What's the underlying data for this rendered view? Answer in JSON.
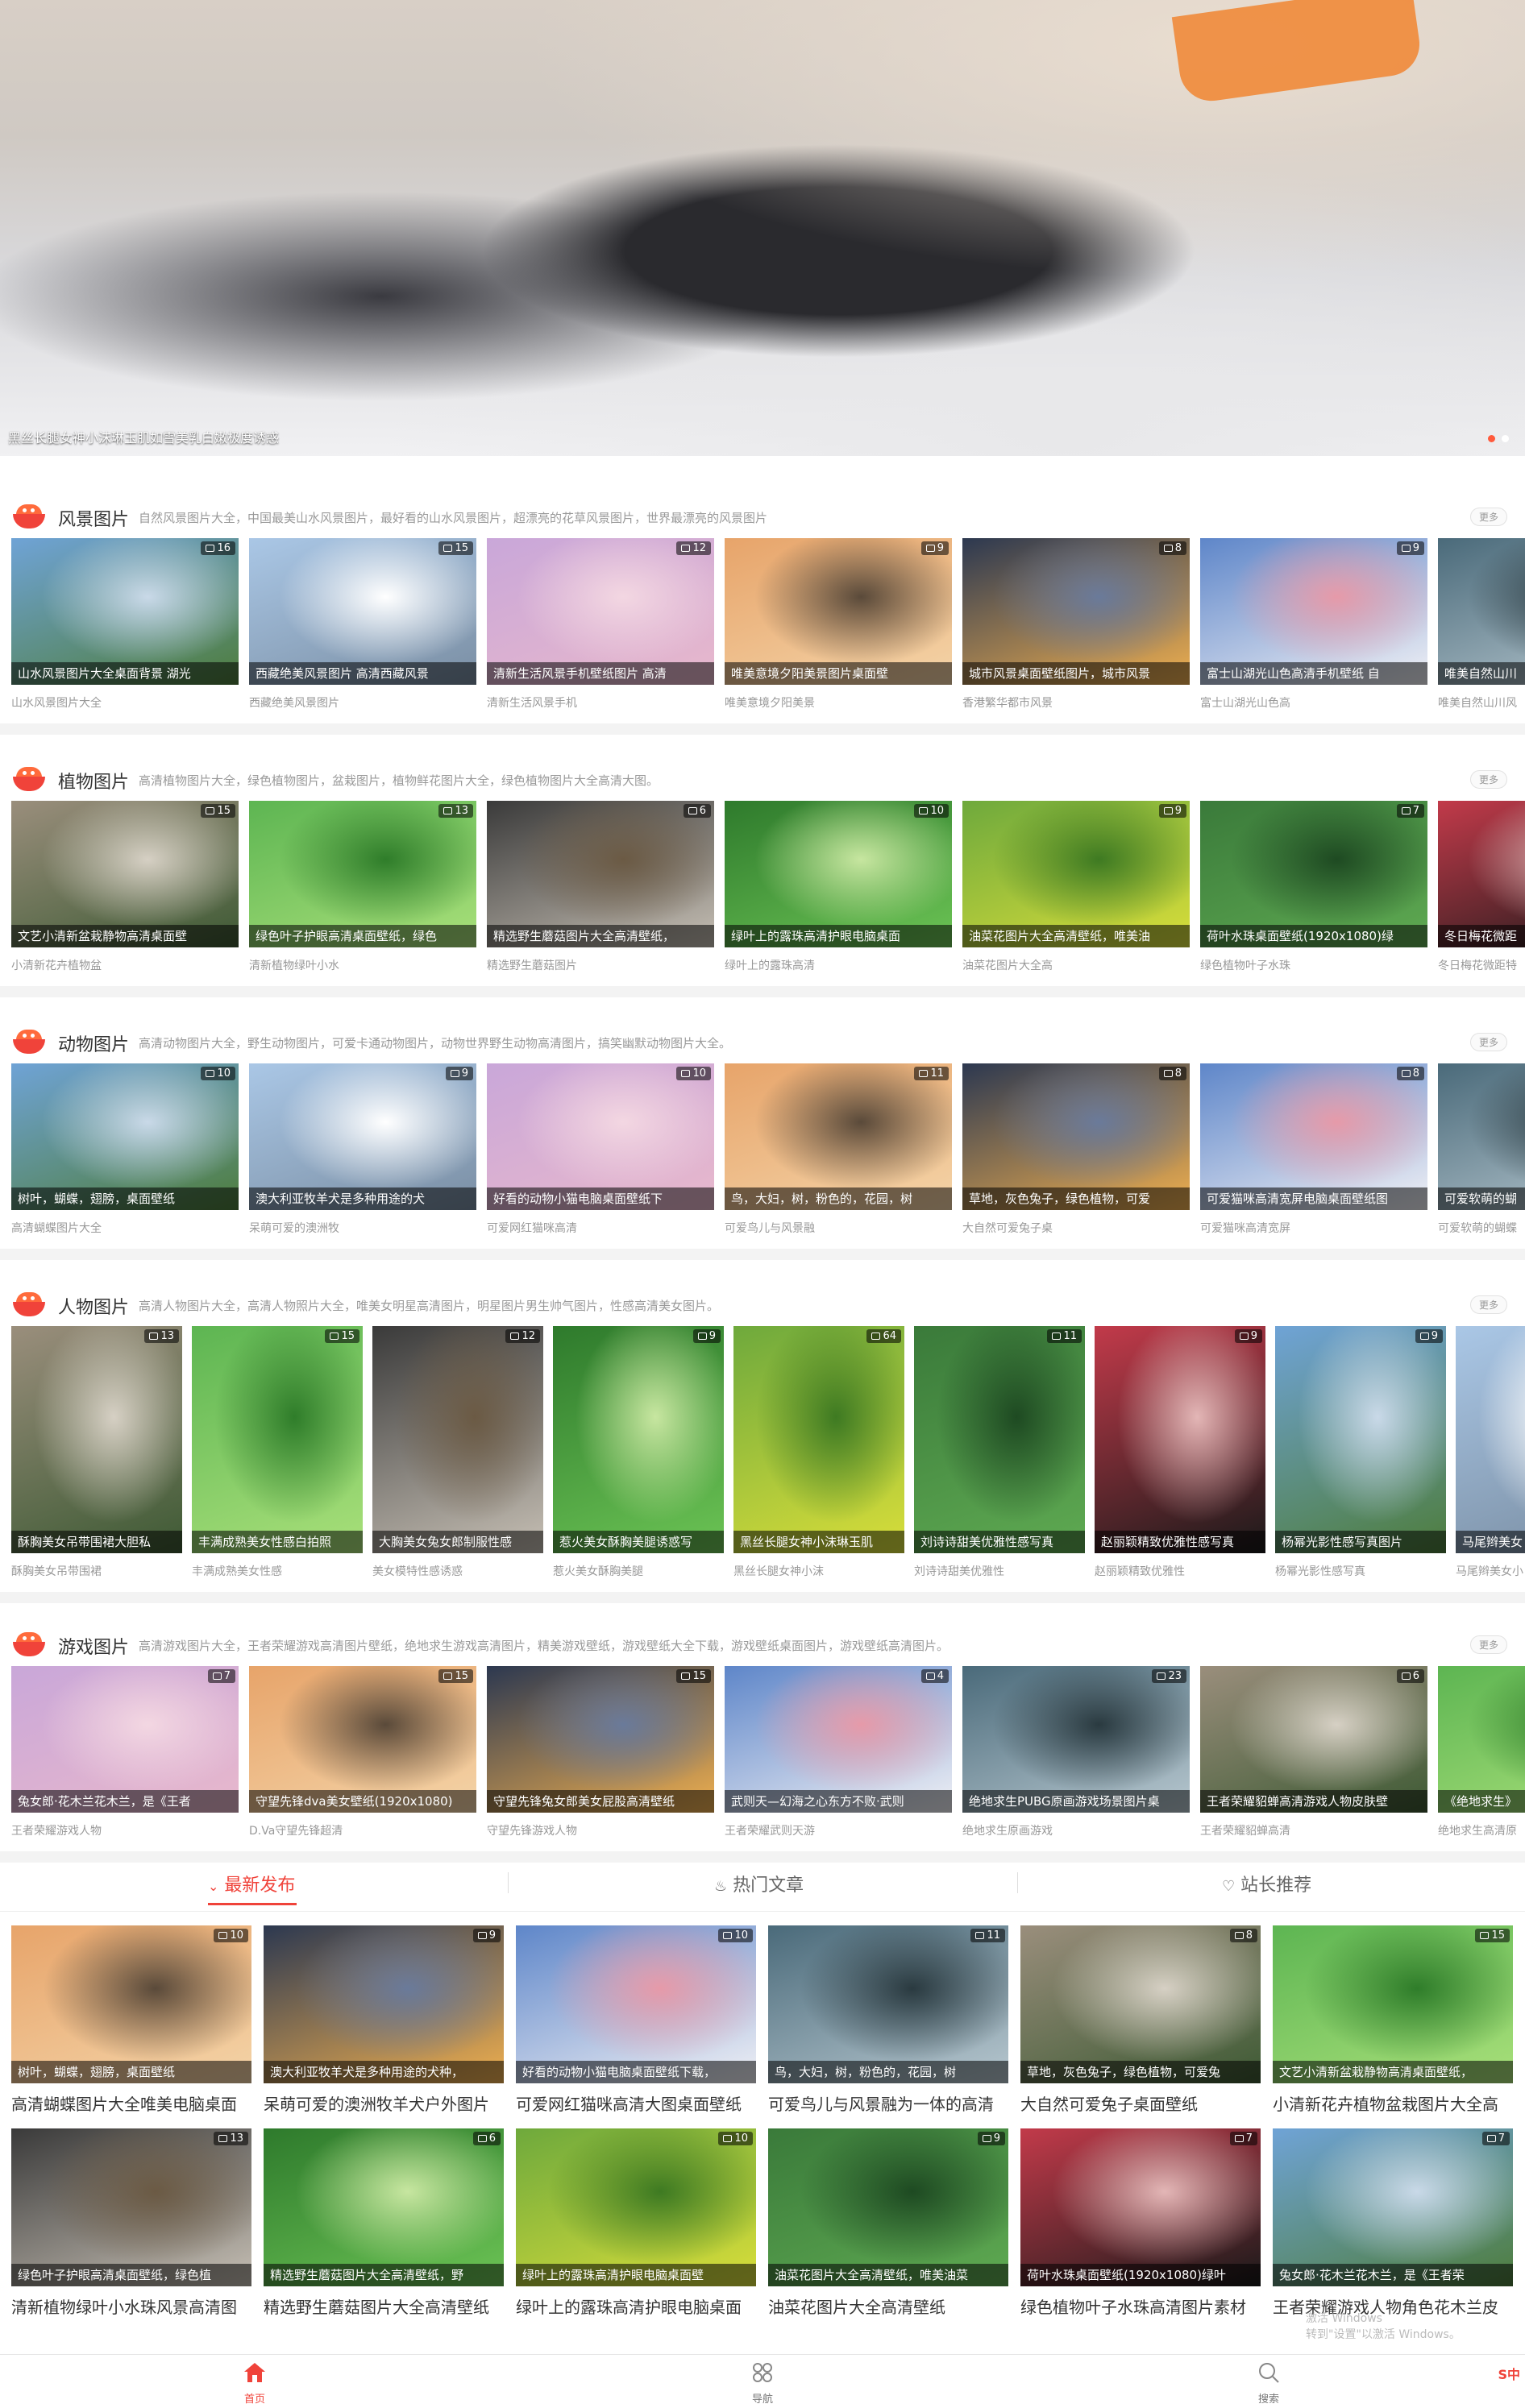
{
  "hero": {
    "caption": "黑丝长腿女神小沫琳玉肌如雪美乳白嫩极度诱惑",
    "dots": 2,
    "active_dot": 0
  },
  "more_label": "更多",
  "sections": [
    {
      "title": "风景图片",
      "desc": "自然风景图片大全，中国最美山水风景图片，最好看的山水风景图片，超漂亮的花草风景图片，世界最漂亮的风景图片",
      "items": [
        {
          "overlay": "山水风景图片大全桌面背景 湖光",
          "sub": "山水风景图片大全",
          "count": "16"
        },
        {
          "overlay": "西藏绝美风景图片 高清西藏风景",
          "sub": "西藏绝美风景图片",
          "count": "15"
        },
        {
          "overlay": "清新生活风景手机壁纸图片 高清",
          "sub": "清新生活风景手机",
          "count": "12"
        },
        {
          "overlay": "唯美意境夕阳美景图片桌面壁",
          "sub": "唯美意境夕阳美景",
          "count": "9"
        },
        {
          "overlay": "城市风景桌面壁纸图片，城市风景",
          "sub": "香港繁华都市风景",
          "count": "8"
        },
        {
          "overlay": "富士山湖光山色高清手机壁纸 自",
          "sub": "富士山湖光山色高",
          "count": "9"
        },
        {
          "overlay": "唯美自然山川",
          "sub": "唯美自然山川风",
          "count": ""
        }
      ]
    },
    {
      "title": "植物图片",
      "desc": "高清植物图片大全，绿色植物图片，盆栽图片，植物鲜花图片大全，绿色植物图片大全高清大图。",
      "items": [
        {
          "overlay": "文艺小清新盆栽静物高清桌面壁",
          "sub": "小清新花卉植物盆",
          "count": "15"
        },
        {
          "overlay": "绿色叶子护眼高清桌面壁纸，绿色",
          "sub": "清新植物绿叶小水",
          "count": "13"
        },
        {
          "overlay": "精选野生蘑菇图片大全高清壁纸，",
          "sub": "精选野生蘑菇图片",
          "count": "6"
        },
        {
          "overlay": "绿叶上的露珠高清护眼电脑桌面",
          "sub": "绿叶上的露珠高清",
          "count": "10"
        },
        {
          "overlay": "油菜花图片大全高清壁纸，唯美油",
          "sub": "油菜花图片大全高",
          "count": "9"
        },
        {
          "overlay": "荷叶水珠桌面壁纸(1920x1080)绿",
          "sub": "绿色植物叶子水珠",
          "count": "7"
        },
        {
          "overlay": "冬日梅花微距",
          "sub": "冬日梅花微距特",
          "count": ""
        }
      ]
    },
    {
      "title": "动物图片",
      "desc": "高清动物图片大全，野生动物图片，可爱卡通动物图片，动物世界野生动物高清图片，搞笑幽默动物图片大全。",
      "items": [
        {
          "overlay": "树叶，蝴蝶，翅膀，桌面壁纸",
          "sub": "高清蝴蝶图片大全",
          "count": "10"
        },
        {
          "overlay": "澳大利亚牧羊犬是多种用途的犬",
          "sub": "呆萌可爱的澳洲牧",
          "count": "9"
        },
        {
          "overlay": "好看的动物小猫电脑桌面壁纸下",
          "sub": "可爱网红猫咪高清",
          "count": "10"
        },
        {
          "overlay": "鸟，大妇，树，粉色的，花园，树",
          "sub": "可爱鸟儿与风景融",
          "count": "11"
        },
        {
          "overlay": "草地，灰色兔子，绿色植物，可爱",
          "sub": "大自然可爱兔子桌",
          "count": "8"
        },
        {
          "overlay": "可爱猫咪高清宽屏电脑桌面壁纸图",
          "sub": "可爱猫咪高清宽屏",
          "count": "8"
        },
        {
          "overlay": "可爱软萌的蝴",
          "sub": "可爱软萌的蝴蝶",
          "count": ""
        }
      ]
    },
    {
      "title": "人物图片",
      "desc": "高清人物图片大全，高清人物照片大全，唯美女明星高清图片，明星图片男生帅气图片，性感高清美女图片。",
      "items": [
        {
          "overlay": "酥胸美女吊带围裙大胆私",
          "sub": "酥胸美女吊带围裙",
          "count": "13"
        },
        {
          "overlay": "丰满成熟美女性感白拍照",
          "sub": "丰满成熟美女性感",
          "count": "15"
        },
        {
          "overlay": "大胸美女兔女郎制服性感",
          "sub": "美女模特性感诱惑",
          "count": "12"
        },
        {
          "overlay": "惹火美女酥胸美腿诱惑写",
          "sub": "惹火美女酥胸美腿",
          "count": "9"
        },
        {
          "overlay": "黑丝长腿女神小沫琳玉肌",
          "sub": "黑丝长腿女神小沫",
          "count": "64"
        },
        {
          "overlay": "刘诗诗甜美优雅性感写真",
          "sub": "刘诗诗甜美优雅性",
          "count": "11"
        },
        {
          "overlay": "赵丽颖精致优雅性感写真",
          "sub": "赵丽颖精致优雅性",
          "count": "9"
        },
        {
          "overlay": "杨幂光影性感写真图片",
          "sub": "杨幂光影性感写真",
          "count": "9"
        },
        {
          "overlay": "马尾辫美女",
          "sub": "马尾辫美女小",
          "count": ""
        }
      ]
    },
    {
      "title": "游戏图片",
      "desc": "高清游戏图片大全，王者荣耀游戏高清图片壁纸，绝地求生游戏高清图片，精美游戏壁纸，游戏壁纸大全下载，游戏壁纸桌面图片，游戏壁纸高清图片。",
      "items": [
        {
          "overlay": "兔女郎·花木兰花木兰，是《王者",
          "sub": "王者荣耀游戏人物",
          "count": "7"
        },
        {
          "overlay": "守望先锋dva美女壁纸(1920x1080)",
          "sub": "D.Va守望先锋超清",
          "count": "15"
        },
        {
          "overlay": "守望先锋兔女郎美女屁股高清壁纸",
          "sub": "守望先锋游戏人物",
          "count": "15"
        },
        {
          "overlay": "武则天—幻海之心东方不败·武则",
          "sub": "王者荣耀武则天游",
          "count": "4"
        },
        {
          "overlay": "绝地求生PUBG原画游戏场景图片桌",
          "sub": "绝地求生原画游戏",
          "count": "23"
        },
        {
          "overlay": "王者荣耀貂蝉高清游戏人物皮肤壁",
          "sub": "王者荣耀貂蝉高清",
          "count": "6"
        },
        {
          "overlay": "《绝地求生》",
          "sub": "绝地求生高清原",
          "count": ""
        }
      ]
    }
  ],
  "tabs": [
    {
      "label": "最新发布",
      "active": true
    },
    {
      "label": "热门文章",
      "active": false
    },
    {
      "label": "站长推荐",
      "active": false
    }
  ],
  "latest": [
    {
      "overlay": "树叶，蝴蝶，翅膀，桌面壁纸",
      "caption": "高清蝴蝶图片大全唯美电脑桌面",
      "count": "10"
    },
    {
      "overlay": "澳大利亚牧羊犬是多种用途的犬种，",
      "caption": "呆萌可爱的澳洲牧羊犬户外图片",
      "count": "9"
    },
    {
      "overlay": "好看的动物小猫电脑桌面壁纸下载，",
      "caption": "可爱网红猫咪高清大图桌面壁纸",
      "count": "10"
    },
    {
      "overlay": "鸟，大妇，树，粉色的，花园，树",
      "caption": "可爱鸟儿与风景融为一体的高清",
      "count": "11"
    },
    {
      "overlay": "草地，灰色兔子，绿色植物，可爱兔",
      "caption": "大自然可爱兔子桌面壁纸",
      "count": "8"
    },
    {
      "overlay": "文艺小清新盆栽静物高清桌面壁纸，",
      "caption": "小清新花卉植物盆栽图片大全高",
      "count": "15"
    },
    {
      "overlay": "绿色叶子护眼高清桌面壁纸，绿色植",
      "caption": "清新植物绿叶小水珠风景高清图",
      "count": "13"
    },
    {
      "overlay": "精选野生蘑菇图片大全高清壁纸，野",
      "caption": "精选野生蘑菇图片大全高清壁纸",
      "count": "6"
    },
    {
      "overlay": "绿叶上的露珠高清护眼电脑桌面壁",
      "caption": "绿叶上的露珠高清护眼电脑桌面",
      "count": "10"
    },
    {
      "overlay": "油菜花图片大全高清壁纸，唯美油菜",
      "caption": "油菜花图片大全高清壁纸",
      "count": "9"
    },
    {
      "overlay": "荷叶水珠桌面壁纸(1920x1080)绿叶",
      "caption": "绿色植物叶子水珠高清图片素材",
      "count": "7"
    },
    {
      "overlay": "兔女郎·花木兰花木兰，是《王者荣",
      "caption": "王者荣耀游戏人物角色花木兰皮",
      "count": "7"
    }
  ],
  "bottom_nav": [
    {
      "label": "首页",
      "icon": "home-icon",
      "active": true
    },
    {
      "label": "导航",
      "icon": "grid-icon",
      "active": false
    },
    {
      "label": "搜索",
      "icon": "search-icon",
      "active": false
    }
  ],
  "watermark": {
    "line1": "激活 Windows",
    "line2": "转到\"设置\"以激活 Windows。"
  },
  "colors": {
    "accent": "#f0433a",
    "accent_light": "#ff6b3c"
  }
}
